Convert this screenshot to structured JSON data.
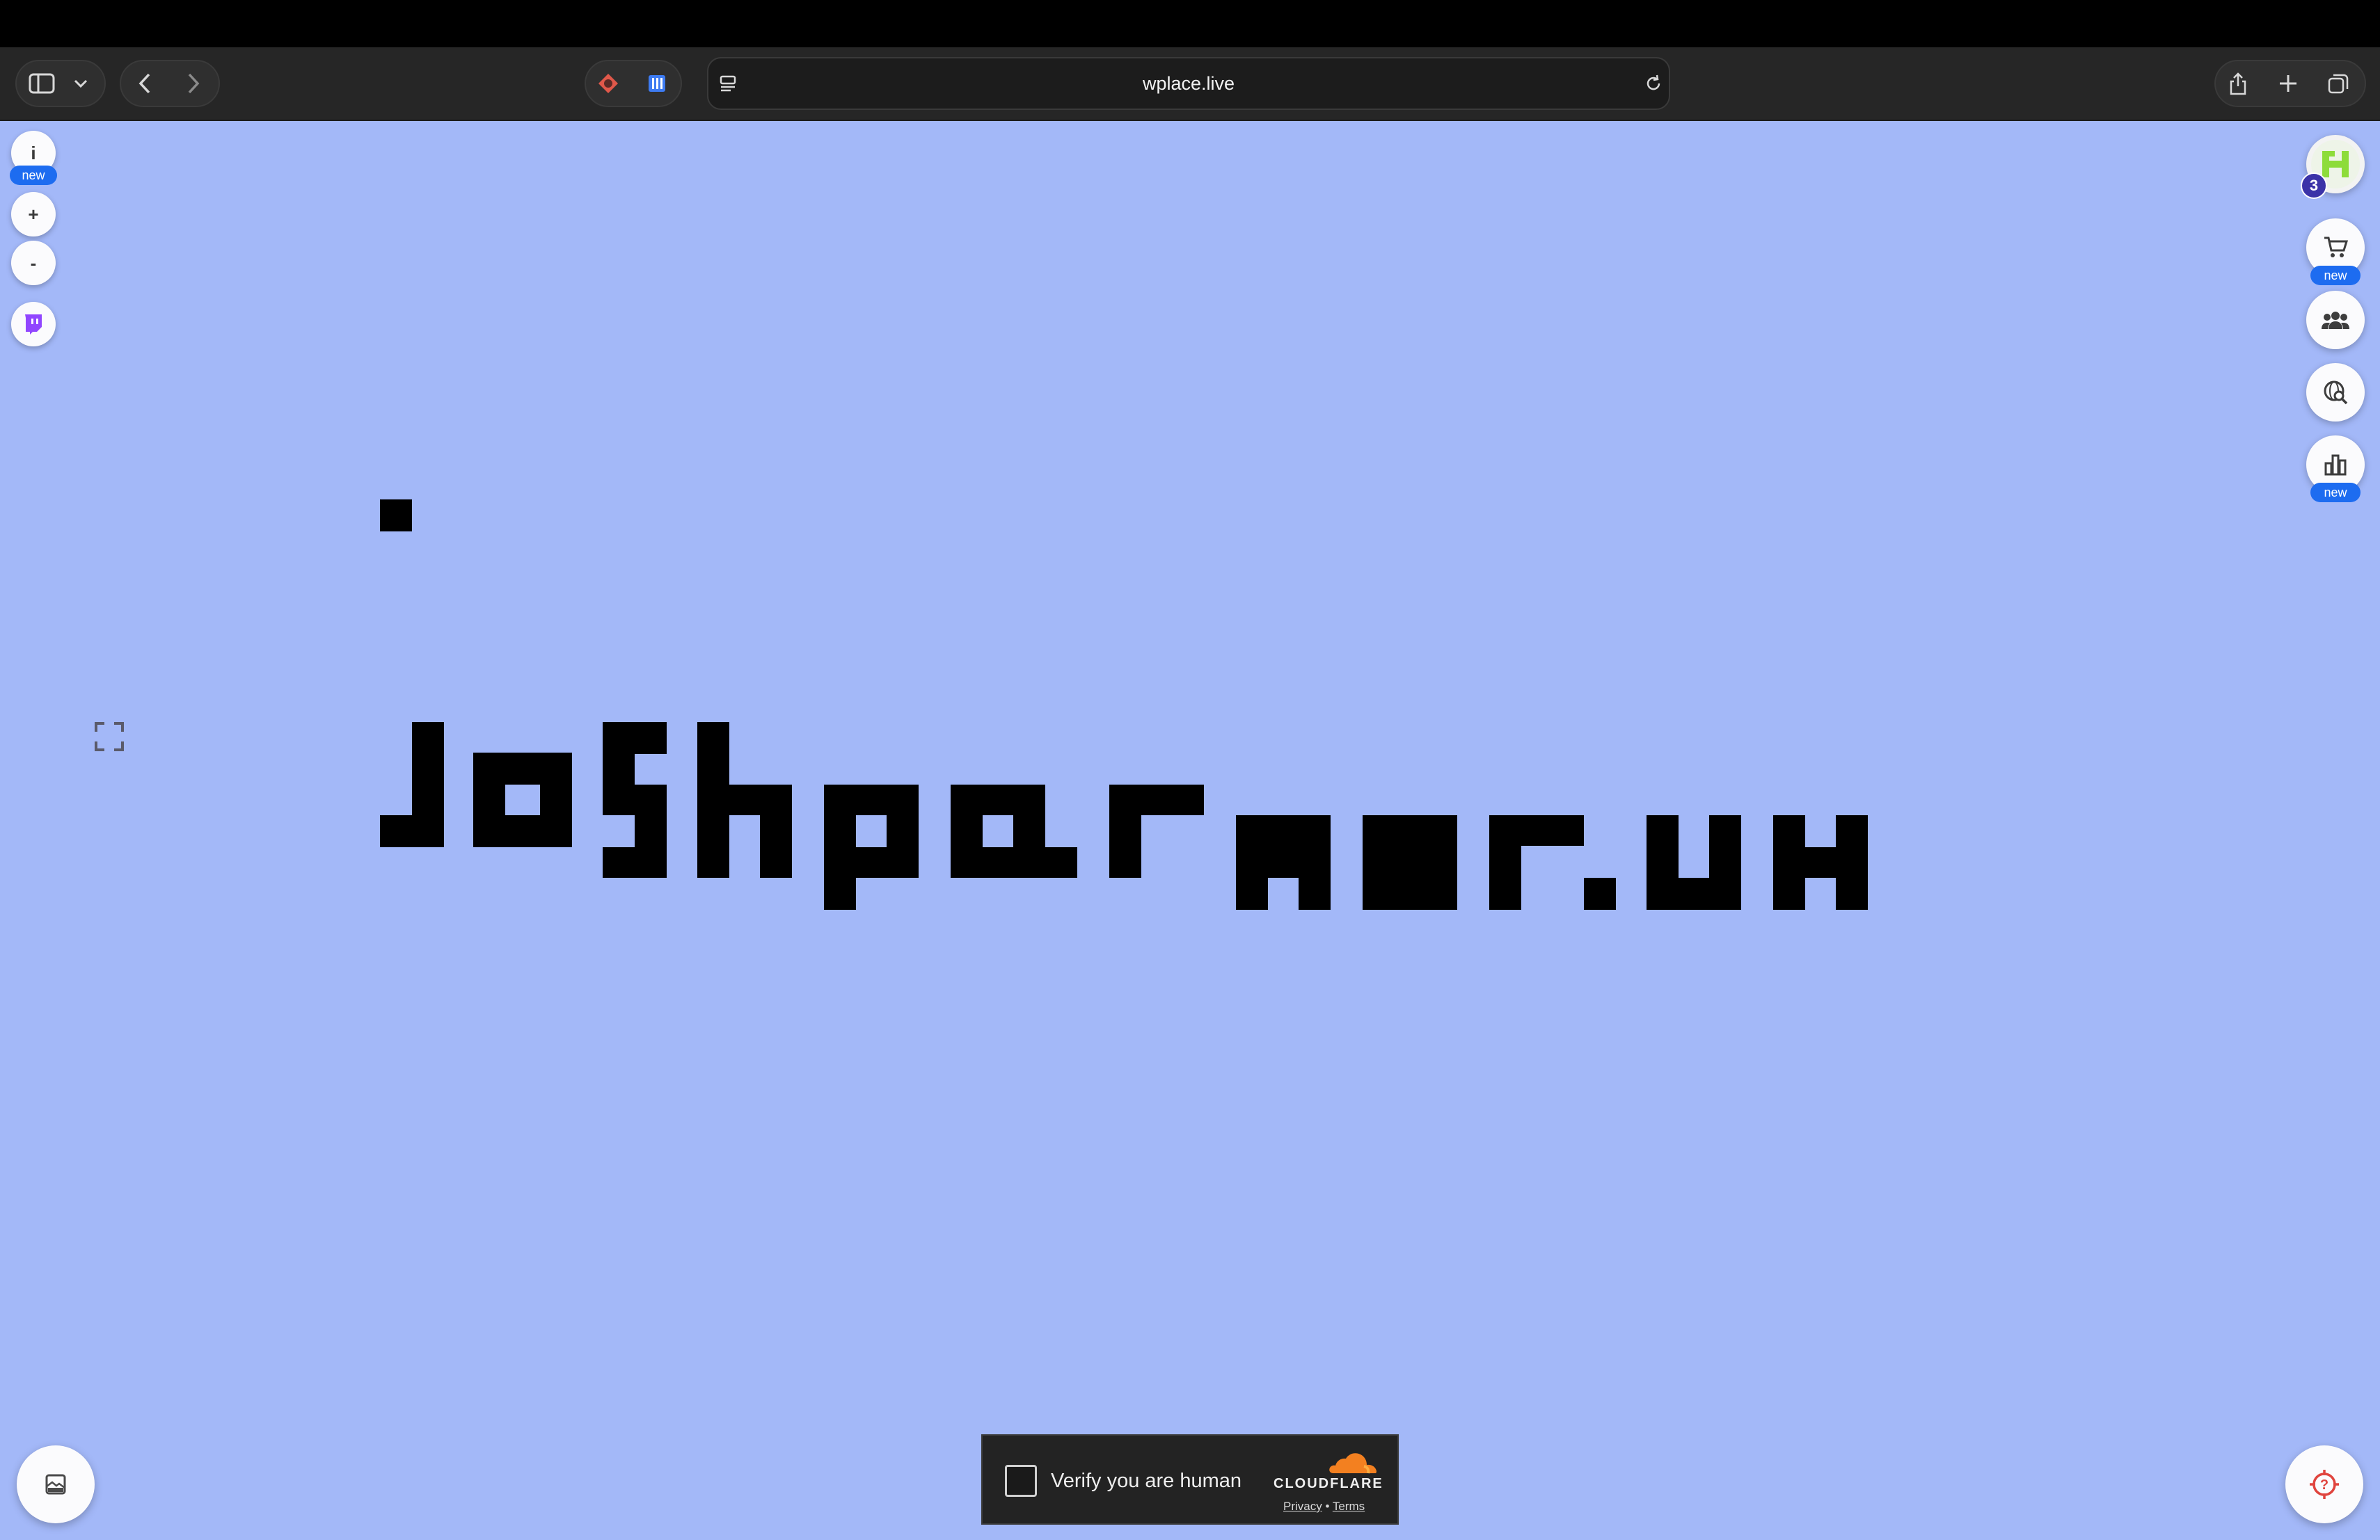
{
  "browser": {
    "url": "wplace.live"
  },
  "map_controls": {
    "info_label": "i",
    "info_badge": "new",
    "zoom_in_label": "+",
    "zoom_out_label": "-"
  },
  "right_controls": {
    "profile_count": "3",
    "store_badge": "new",
    "leaderboard_badge": "new"
  },
  "captcha": {
    "label": "Verify you are human",
    "brand": "CLOUDFLARE",
    "privacy_link": "Privacy",
    "separator": "•",
    "terms_link": "Terms"
  },
  "canvas": {
    "background_color": "#a3b8f8",
    "pixel_color": "#000000"
  },
  "colors": {
    "accent": "#1d6cf0",
    "twitch": "#9146ff",
    "avatar_green": "#8ddc3a",
    "locate": "#e0443e",
    "cloudflare_orange": "#f38020"
  }
}
